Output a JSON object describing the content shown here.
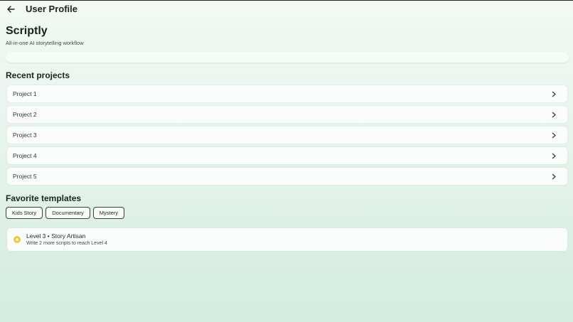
{
  "header": {
    "title": "User Profile",
    "back_icon": "arrow-left-icon"
  },
  "app": {
    "name": "Scriptly",
    "tagline": "All-in-one AI storytelling workflow"
  },
  "recent_projects": {
    "title": "Recent projects",
    "items": [
      {
        "label": "Project 1"
      },
      {
        "label": "Project 2"
      },
      {
        "label": "Project 3"
      },
      {
        "label": "Project 4"
      },
      {
        "label": "Project 5"
      }
    ]
  },
  "favorite_templates": {
    "title": "Favorite templates",
    "chips": [
      "Kids Story",
      "Documentary",
      "Mystery"
    ]
  },
  "level": {
    "title": "Level 3 • Story Artisan",
    "subtitle": "Write 2 more scripts to reach Level 4",
    "icon": "star-badge-icon",
    "icon_color": "#f0c93a"
  }
}
